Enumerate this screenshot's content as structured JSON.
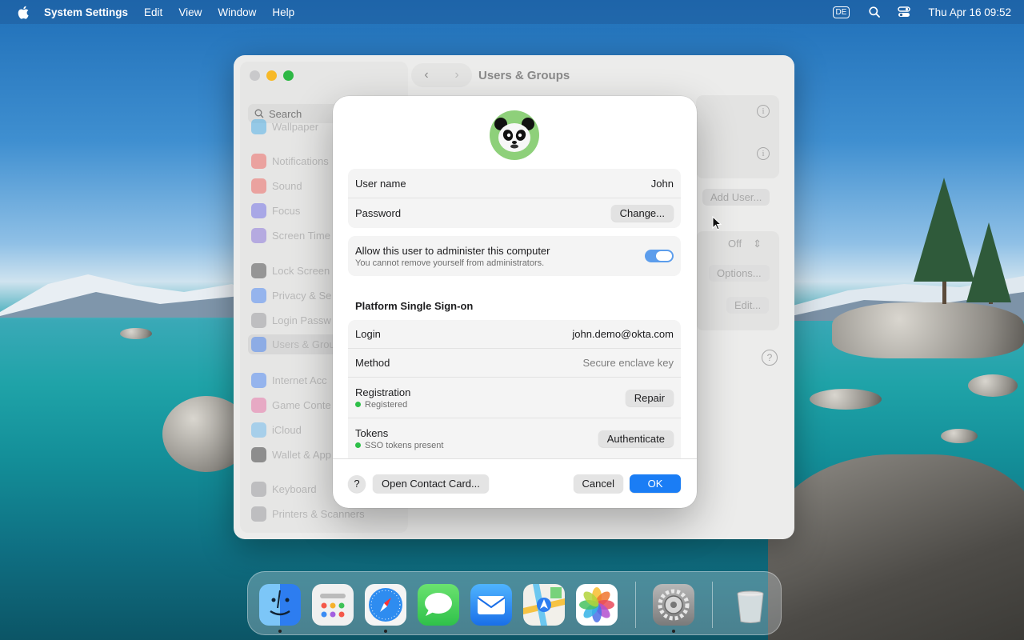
{
  "menubar": {
    "app_name": "System Settings",
    "menus": [
      "Edit",
      "View",
      "Window",
      "Help"
    ],
    "input_source": "DE",
    "clock": "Thu Apr 16  09:52"
  },
  "window": {
    "title": "Users & Groups",
    "search_placeholder": "Search",
    "sidebar_items": [
      "Wallpaper",
      "Notifications",
      "Sound",
      "Focus",
      "Screen Time",
      "Lock Screen",
      "Privacy & Se",
      "Login Passw",
      "Users & Grou",
      "Internet Acc",
      "Game Conte",
      "iCloud",
      "Wallet & App",
      "Keyboard",
      "Printers & Scanners"
    ],
    "add_user_label": "Add User...",
    "off_label": "Off",
    "options_label": "Options...",
    "edit_label": "Edit...",
    "help_label": "?"
  },
  "sheet": {
    "user_name_label": "User name",
    "user_name_value": "John",
    "password_label": "Password",
    "change_button": "Change...",
    "admin_label": "Allow this user to administer this computer",
    "admin_note": "You cannot remove yourself from administrators.",
    "admin_enabled": true,
    "sso_section_title": "Platform Single Sign-on",
    "login_label": "Login",
    "login_value": "john.demo@okta.com",
    "method_label": "Method",
    "method_value": "Secure enclave key",
    "registration_label": "Registration",
    "registration_status": "Registered",
    "repair_button": "Repair",
    "tokens_label": "Tokens",
    "tokens_status": "SSO tokens present",
    "authenticate_button": "Authenticate",
    "help_button": "?",
    "open_contact_button": "Open Contact Card...",
    "cancel_button": "Cancel",
    "ok_button": "OK"
  },
  "dock": {
    "apps": [
      "Finder",
      "Launchpad",
      "Safari",
      "Messages",
      "Mail",
      "Maps",
      "Photos",
      "System Settings",
      "Trash"
    ]
  },
  "colors": {
    "accent": "#1a7df5",
    "toggle_on": "#5c9dec",
    "status_green": "#2dbf48"
  }
}
